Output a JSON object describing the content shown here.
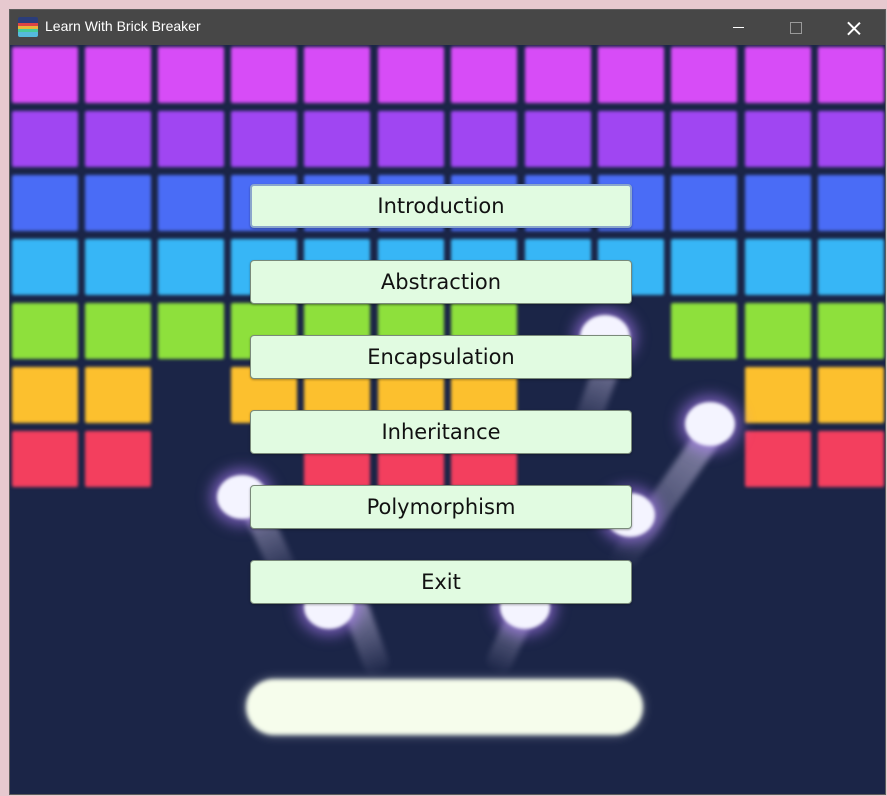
{
  "window": {
    "title": "Learn With Brick Breaker",
    "icon": "brick-breaker-app-icon"
  },
  "controls": {
    "minimize_icon": "minimize-icon",
    "maximize_icon": "maximize-icon",
    "close_icon": "close-icon"
  },
  "menu": {
    "buttons": [
      {
        "label": "Introduction",
        "focused": true
      },
      {
        "label": "Abstraction"
      },
      {
        "label": "Encapsulation"
      },
      {
        "label": "Inheritance"
      },
      {
        "label": "Polymorphism"
      },
      {
        "label": "Exit"
      }
    ]
  },
  "colors": {
    "background": "#1b2547",
    "button_fill": "#e1fbe1",
    "row_colors": [
      "#d74cf7",
      "#a046f2",
      "#4a6cf6",
      "#37b6f6",
      "#8ee03c",
      "#fcc02e",
      "#f33f5e"
    ]
  }
}
